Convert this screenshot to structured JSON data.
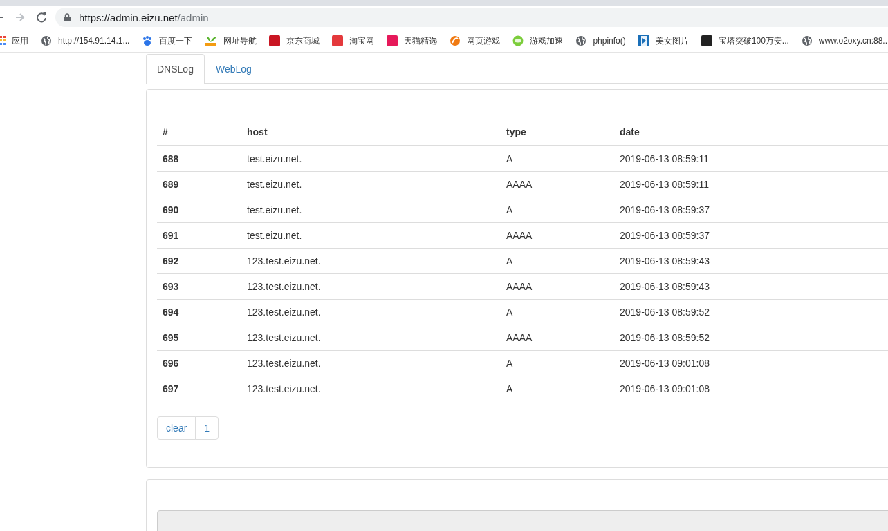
{
  "browser": {
    "url_host": "https://admin.eizu.net",
    "url_path": "/admin",
    "bookmarks": [
      {
        "label": "应用",
        "kind": "apps"
      },
      {
        "label": "http://154.91.14.1...",
        "kind": "globe"
      },
      {
        "label": "百度一下",
        "kind": "paw"
      },
      {
        "label": "网址导航",
        "kind": "leaf"
      },
      {
        "label": "京东商城",
        "kind": "jd"
      },
      {
        "label": "淘宝网",
        "kind": "tao"
      },
      {
        "label": "天猫精选",
        "kind": "ju"
      },
      {
        "label": "网页游戏",
        "kind": "flame"
      },
      {
        "label": "游戏加速",
        "kind": "green"
      },
      {
        "label": "phpinfo()",
        "kind": "globe"
      },
      {
        "label": "美女图片",
        "kind": "film"
      },
      {
        "label": "宝塔突破100万安...",
        "kind": "bt"
      },
      {
        "label": "www.o2oxy.cn:88...",
        "kind": "globe"
      }
    ]
  },
  "tabs": [
    {
      "label": "DNSLog",
      "selected": true
    },
    {
      "label": "WebLog",
      "selected": false
    }
  ],
  "table": {
    "columns": [
      "#",
      "host",
      "type",
      "date"
    ],
    "rows": [
      [
        "688",
        "test.eizu.net.",
        "A",
        "2019-06-13 08:59:11"
      ],
      [
        "689",
        "test.eizu.net.",
        "AAAA",
        "2019-06-13 08:59:11"
      ],
      [
        "690",
        "test.eizu.net.",
        "A",
        "2019-06-13 08:59:37"
      ],
      [
        "691",
        "test.eizu.net.",
        "AAAA",
        "2019-06-13 08:59:37"
      ],
      [
        "692",
        "123.test.eizu.net.",
        "A",
        "2019-06-13 08:59:43"
      ],
      [
        "693",
        "123.test.eizu.net.",
        "AAAA",
        "2019-06-13 08:59:43"
      ],
      [
        "694",
        "123.test.eizu.net.",
        "A",
        "2019-06-13 08:59:52"
      ],
      [
        "695",
        "123.test.eizu.net.",
        "AAAA",
        "2019-06-13 08:59:52"
      ],
      [
        "696",
        "123.test.eizu.net.",
        "A",
        "2019-06-13 09:01:08"
      ],
      [
        "697",
        "123.test.eizu.net.",
        "A",
        "2019-06-13 09:01:08"
      ]
    ]
  },
  "pagination": [
    {
      "label": "clear"
    },
    {
      "label": "1"
    }
  ]
}
